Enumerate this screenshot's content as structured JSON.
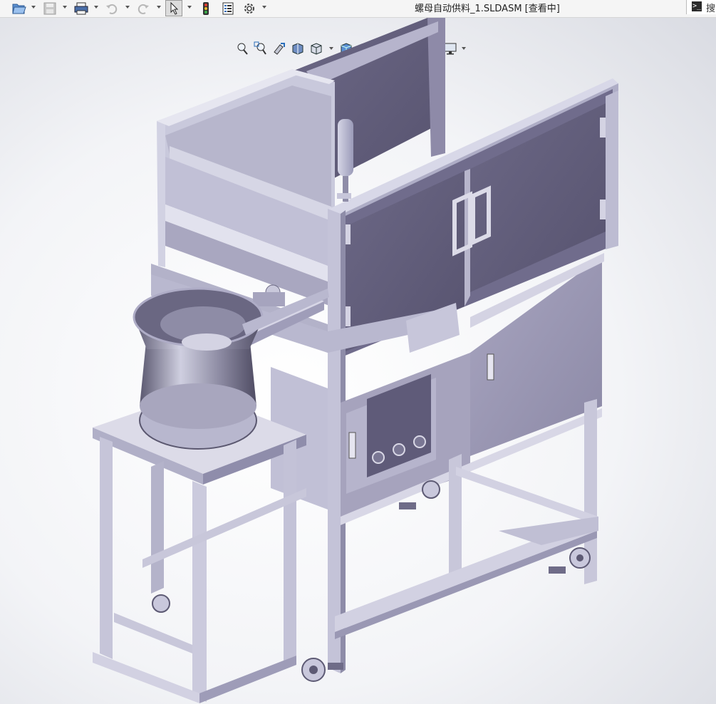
{
  "window": {
    "title": "螺母自动供料_1.SLDASM [查看中]"
  },
  "toolbar": {
    "items": [
      "open",
      "save",
      "print",
      "undo",
      "redo",
      "select",
      "rebuild",
      "file-properties",
      "options"
    ],
    "search_label": "搜"
  },
  "heads_up_view_toolbar": {
    "items": [
      "zoom-to-fit",
      "zoom-to-area",
      "previous-view",
      "section-view",
      "view-orientation",
      "display-style",
      "display-settings"
    ]
  },
  "colors": {
    "model_steel": "#b9b9cf",
    "model_panel": "#7a7596",
    "background": "#f3f4f7",
    "accent": "#2a6ebb"
  },
  "model": {
    "description_name": "螺母自动供料_1"
  }
}
